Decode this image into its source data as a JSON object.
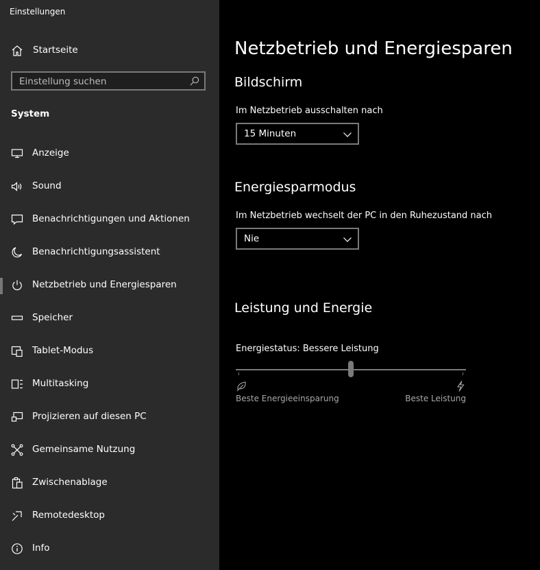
{
  "app": {
    "title": "Einstellungen"
  },
  "sidebar": {
    "home_label": "Startseite",
    "search_placeholder": "Einstellung suchen",
    "section": "System",
    "items": [
      {
        "label": "Anzeige",
        "icon": "monitor-icon"
      },
      {
        "label": "Sound",
        "icon": "speaker-icon"
      },
      {
        "label": "Benachrichtigungen und Aktionen",
        "icon": "message-icon"
      },
      {
        "label": "Benachrichtigungsassistent",
        "icon": "moon-icon"
      },
      {
        "label": "Netzbetrieb und Energiesparen",
        "icon": "power-icon",
        "active": true
      },
      {
        "label": "Speicher",
        "icon": "storage-icon"
      },
      {
        "label": "Tablet-Modus",
        "icon": "tablet-icon"
      },
      {
        "label": "Multitasking",
        "icon": "multitasking-icon"
      },
      {
        "label": "Projizieren auf diesen PC",
        "icon": "project-icon"
      },
      {
        "label": "Gemeinsame Nutzung",
        "icon": "share-icon"
      },
      {
        "label": "Zwischenablage",
        "icon": "clipboard-icon"
      },
      {
        "label": "Remotedesktop",
        "icon": "remote-icon"
      },
      {
        "label": "Info",
        "icon": "info-icon"
      }
    ]
  },
  "main": {
    "title": "Netzbetrieb und Energiesparen",
    "screen": {
      "heading": "Bildschirm",
      "label": "Im Netzbetrieb ausschalten nach",
      "value": "15 Minuten"
    },
    "sleep": {
      "heading": "Energiesparmodus",
      "label": "Im Netzbetrieb wechselt der PC in den Ruhezustand nach",
      "value": "Nie"
    },
    "performance": {
      "heading": "Leistung und Energie",
      "status": "Energiestatus: Bessere Leistung",
      "slider_level": 0.5,
      "min_label": "Beste Energieeinsparung",
      "max_label": "Beste Leistung"
    }
  }
}
